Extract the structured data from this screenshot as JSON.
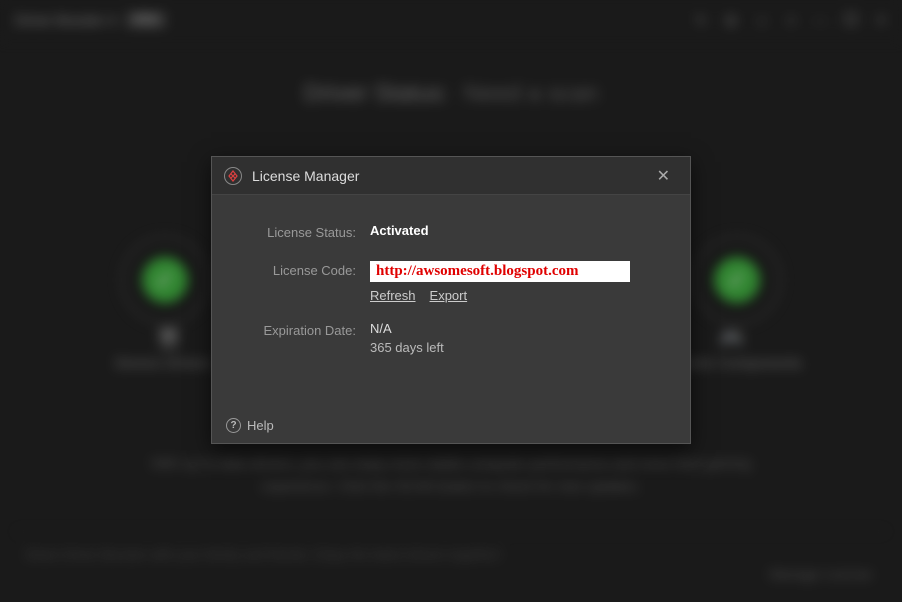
{
  "background": {
    "app_title": "Driver Booster 4",
    "edition_badge": "PRO",
    "status_label": "Driver Status:",
    "status_value": "Need a scan",
    "left_section": "Device Drivers",
    "right_section": "Game Components",
    "footer_line1": "With up-to-date drivers, you can enjoy more stable computer performance and more fluid gaming",
    "footer_line2": "experience. Click the SCAN button to check for new updates.",
    "share_text": "Share Driver Booster with your family and friends. Enjoy the latest drivers together!",
    "manage_license": "Manage License"
  },
  "modal": {
    "title": "License Manager",
    "status_label": "License Status:",
    "status_value": "Activated",
    "code_label": "License Code:",
    "code_value": "http://awsomesoft.blogspot.com",
    "refresh": "Refresh",
    "export": "Export",
    "expiration_label": "Expiration Date:",
    "expiration_value": "N/A",
    "days_left": "365 days left",
    "help": "Help"
  }
}
